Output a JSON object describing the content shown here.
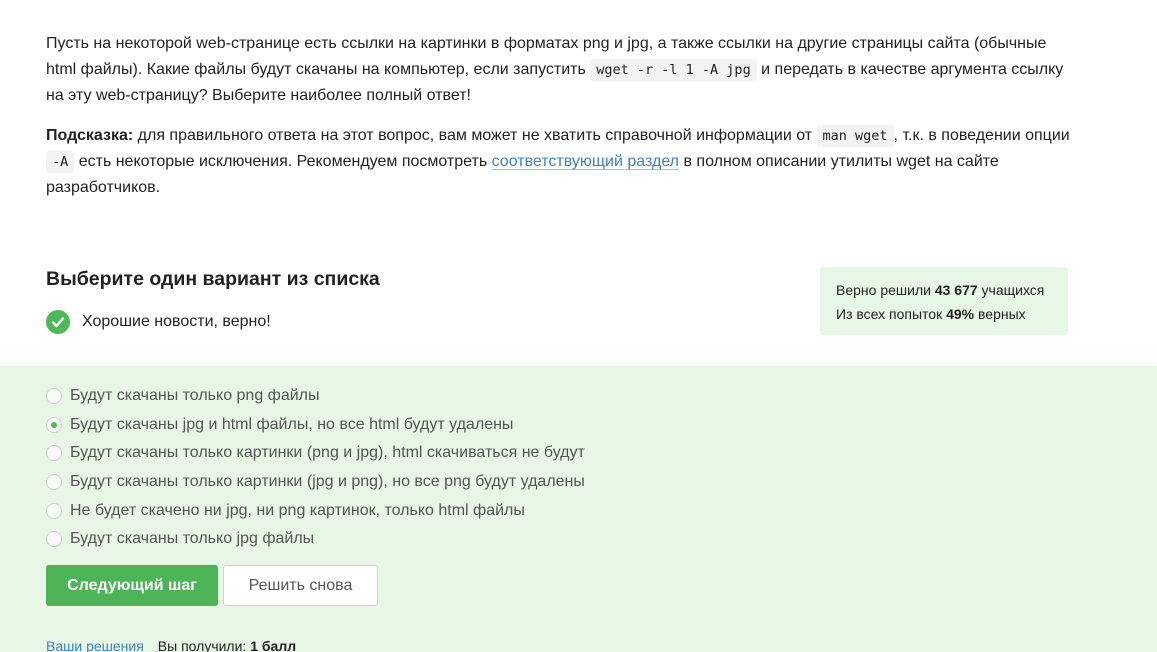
{
  "question": {
    "p1_before_code": "Пусть на некоторой web-странице есть ссылки на картинки в форматах png и jpg, а также ссылки на другие страницы сайта (обычные html файлы). Какие файлы будут скачаны на компьютер, если запустить ",
    "p1_code": "wget -r -l 1 -A jpg",
    "p1_after_code": " и передать в качестве аргумента ссылку на эту web-страницу? Выберите наиболее полный ответ!",
    "hint_label": "Подсказка:",
    "hint_part1": " для правильного ответа на этот вопрос, вам может не хватить справочной информации от ",
    "hint_code1": "man wget",
    "hint_part2": ", т.к. в поведении опции ",
    "hint_code2": "-A",
    "hint_part3": " есть некоторые исключения. Рекомендуем посмотреть ",
    "hint_link": "соответствующий раздел",
    "hint_part4": " в полном описании утилиты wget на сайте разработчиков."
  },
  "choose_title": "Выберите один вариант из списка",
  "result": {
    "text": "Хорошие новости, верно!",
    "color": "#4cb957"
  },
  "stats": {
    "line1_prefix": "Верно решили ",
    "line1_value": "43 677",
    "line1_suffix": " учащихся",
    "line2_prefix": "Из всех попыток ",
    "line2_value": "49%",
    "line2_suffix": " верных"
  },
  "options": [
    {
      "label": "Будут скачаны только png файлы",
      "selected": false
    },
    {
      "label": "Будут скачаны jpg и html файлы, но все html будут удалены",
      "selected": true
    },
    {
      "label": "Будут скачаны только картинки (png и jpg), html скачиваться не будут",
      "selected": false
    },
    {
      "label": "Будут скачаны только картинки (jpg и png), но все png будут удалены",
      "selected": false
    },
    {
      "label": "Не будет скачено ни jpg, ни png картинок, только html файлы",
      "selected": false
    },
    {
      "label": "Будут скачаны только jpg файлы",
      "selected": false
    }
  ],
  "buttons": {
    "next": "Следующий шаг",
    "retry": "Решить снова"
  },
  "footer": {
    "solutions_link": "Ваши решения",
    "score_prefix": "Вы получили: ",
    "score_value": "1 балл"
  },
  "colors": {
    "accent_green": "#4cb357",
    "answers_bg": "#e8f6e6",
    "stats_bg": "#e7f7e6",
    "link": "#3b82c4"
  }
}
